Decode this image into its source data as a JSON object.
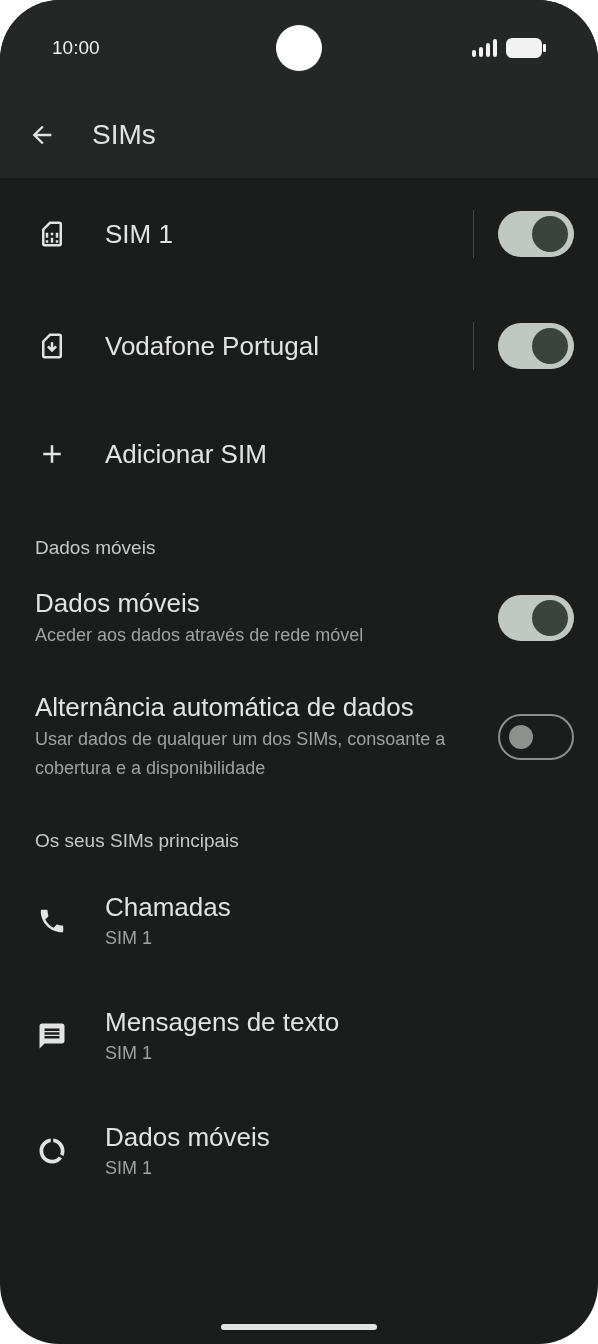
{
  "status_bar": {
    "time": "10:00"
  },
  "app_bar": {
    "title": "SIMs"
  },
  "sim_list": [
    {
      "kind": "sim",
      "title": "SIM 1",
      "on": true
    },
    {
      "kind": "esim",
      "title": "Vodafone Portugal",
      "on": true
    },
    {
      "kind": "add",
      "title": "Adicionar SIM"
    }
  ],
  "sections": [
    {
      "header": "Dados móveis",
      "items": [
        {
          "kind": "switch",
          "title": "Dados móveis",
          "subtitle": "Aceder aos dados através de rede móvel",
          "on": true
        },
        {
          "kind": "switch",
          "title": "Alternância automática de dados",
          "subtitle": "Usar dados de qualquer um dos SIMs, consoante a cobertura e a disponibilidade",
          "on": false
        }
      ]
    },
    {
      "header": "Os seus SIMs principais",
      "items": [
        {
          "kind": "calls",
          "title": "Chamadas",
          "subtitle": "SIM 1"
        },
        {
          "kind": "messages",
          "title": "Mensagens de texto",
          "subtitle": "SIM 1"
        },
        {
          "kind": "data",
          "title": "Dados móveis",
          "subtitle": "SIM 1"
        }
      ]
    }
  ]
}
